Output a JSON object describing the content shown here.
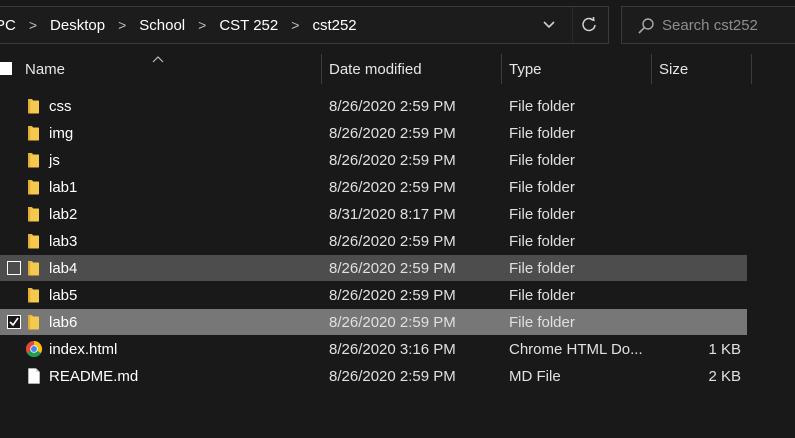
{
  "breadcrumb": [
    "PC",
    "Desktop",
    "School",
    "CST 252",
    "cst252"
  ],
  "search": {
    "placeholder": "Search cst252"
  },
  "columns": {
    "name": "Name",
    "date": "Date modified",
    "type": "Type",
    "size": "Size"
  },
  "files": [
    {
      "name": "css",
      "date": "8/26/2020 2:59 PM",
      "type": "File folder",
      "size": "",
      "icon": "folder-icon",
      "state": "normal"
    },
    {
      "name": "img",
      "date": "8/26/2020 2:59 PM",
      "type": "File folder",
      "size": "",
      "icon": "folder-icon",
      "state": "normal"
    },
    {
      "name": "js",
      "date": "8/26/2020 2:59 PM",
      "type": "File folder",
      "size": "",
      "icon": "folder-icon",
      "state": "normal"
    },
    {
      "name": "lab1",
      "date": "8/26/2020 2:59 PM",
      "type": "File folder",
      "size": "",
      "icon": "folder-icon",
      "state": "normal"
    },
    {
      "name": "lab2",
      "date": "8/31/2020 8:17 PM",
      "type": "File folder",
      "size": "",
      "icon": "folder-icon",
      "state": "normal"
    },
    {
      "name": "lab3",
      "date": "8/26/2020 2:59 PM",
      "type": "File folder",
      "size": "",
      "icon": "folder-icon",
      "state": "normal"
    },
    {
      "name": "lab4",
      "date": "8/26/2020 2:59 PM",
      "type": "File folder",
      "size": "",
      "icon": "folder-icon",
      "state": "hover"
    },
    {
      "name": "lab5",
      "date": "8/26/2020 2:59 PM",
      "type": "File folder",
      "size": "",
      "icon": "folder-icon",
      "state": "normal"
    },
    {
      "name": "lab6",
      "date": "8/26/2020 2:59 PM",
      "type": "File folder",
      "size": "",
      "icon": "folder-icon",
      "state": "selected"
    },
    {
      "name": "index.html",
      "date": "8/26/2020 3:16 PM",
      "type": "Chrome HTML Do...",
      "size": "1 KB",
      "icon": "chrome-icon",
      "state": "normal"
    },
    {
      "name": "README.md",
      "date": "8/26/2020 2:59 PM",
      "type": "MD File",
      "size": "2 KB",
      "icon": "file-icon",
      "state": "normal"
    }
  ],
  "colors": {
    "background": "#191919",
    "hover_row": "#4d4d4d",
    "selected_row": "#777777",
    "folder": "#f1c34f"
  }
}
